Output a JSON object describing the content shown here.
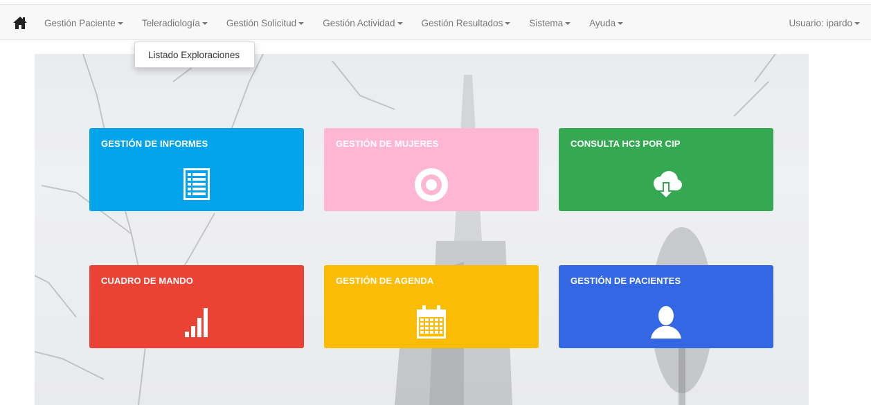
{
  "nav": {
    "home_icon": "home-icon",
    "items": [
      {
        "label": "Gestión Paciente"
      },
      {
        "label": "Teleradiología"
      },
      {
        "label": "Gestión Solicitud"
      },
      {
        "label": "Gestión Actividad"
      },
      {
        "label": "Gestión Resultados"
      },
      {
        "label": "Sistema"
      },
      {
        "label": "Ayuda"
      }
    ],
    "user_label": "Usuario: ipardo"
  },
  "dropdown": {
    "items": [
      {
        "label": "Listado Exploraciones"
      }
    ]
  },
  "tiles": [
    {
      "title": "GESTIÓN DE INFORMES",
      "color": "#03a4ec",
      "icon": "list-document-icon"
    },
    {
      "title": "GESTIÓN DE MUJERES",
      "color": "#feb6d3",
      "icon": "target-icon"
    },
    {
      "title": "CONSULTA HC3 POR CIP",
      "color": "#35a852",
      "icon": "cloud-download-icon"
    },
    {
      "title": "CUADRO DE MANDO",
      "color": "#ea4335",
      "icon": "signal-bars-icon"
    },
    {
      "title": "GESTIÓN DE AGENDA",
      "color": "#fbbc05",
      "icon": "calendar-icon"
    },
    {
      "title": "GESTIÓN DE PACIENTES",
      "color": "#3367e4",
      "icon": "user-icon"
    }
  ]
}
